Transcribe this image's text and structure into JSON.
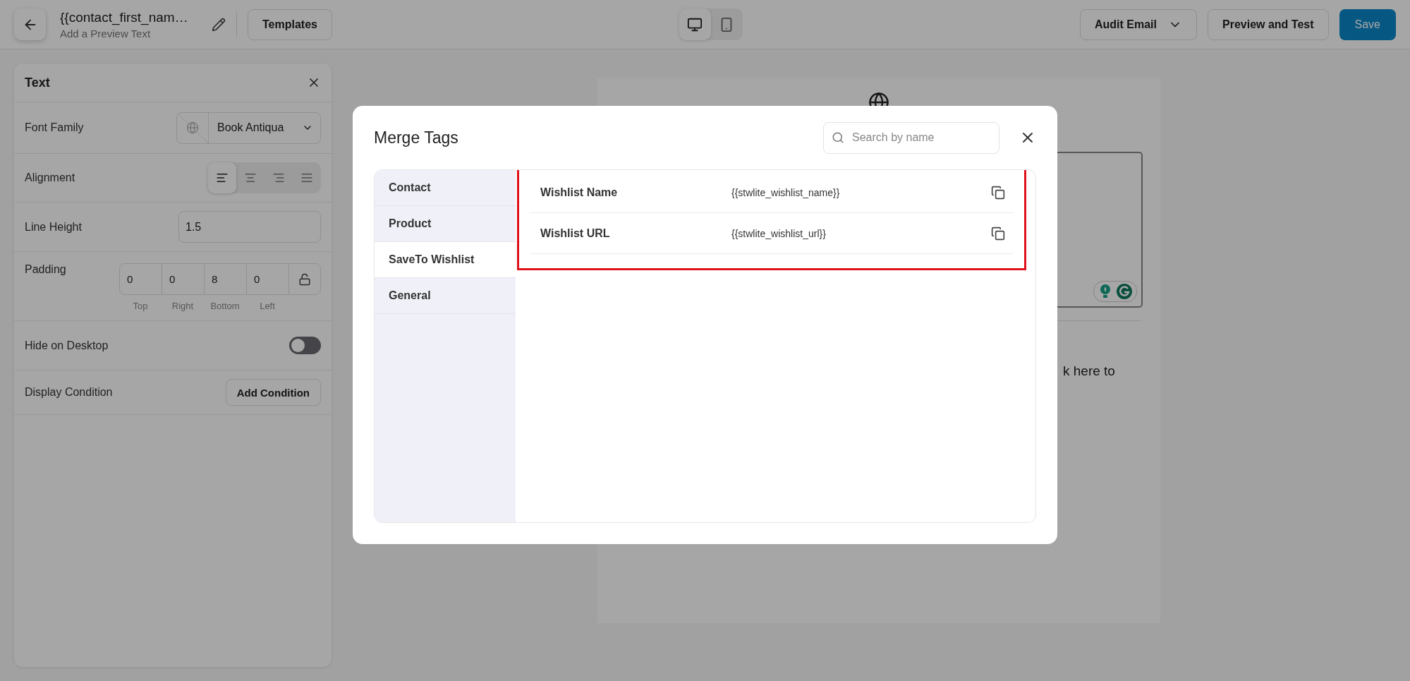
{
  "header": {
    "title": "{{contact_first_nam…",
    "subtitle": "Add a Preview Text",
    "templates_button": "Templates",
    "device_toggle": [
      {
        "kind": "desktop",
        "selected": true
      },
      {
        "kind": "mobile",
        "selected": false
      }
    ],
    "audit_button": "Audit Email",
    "preview_button": "Preview and Test",
    "save_button": "Save"
  },
  "settings_panel": {
    "title": "Text",
    "font_family": {
      "label": "Font Family",
      "value": "Book Antiqua"
    },
    "alignment": {
      "label": "Alignment",
      "options": [
        {
          "kind": "left",
          "selected": true
        },
        {
          "kind": "center",
          "selected": false
        },
        {
          "kind": "right",
          "selected": false
        },
        {
          "kind": "justify",
          "selected": false
        }
      ]
    },
    "line_height": {
      "label": "Line Height",
      "value": "1.5"
    },
    "padding": {
      "label": "Padding",
      "fields": [
        {
          "value": "0",
          "caption": "Top"
        },
        {
          "value": "0",
          "caption": "Right"
        },
        {
          "value": "8",
          "caption": "Bottom"
        },
        {
          "value": "0",
          "caption": "Left"
        }
      ]
    },
    "hide_on_desktop": {
      "label": "Hide on Desktop",
      "on": false
    },
    "display_condition": {
      "label": "Display Condition",
      "button": "Add Condition"
    }
  },
  "canvas": {
    "text_fragment": "k here to"
  },
  "modal": {
    "title": "Merge Tags",
    "search": {
      "placeholder": "Search by name"
    },
    "categories": [
      {
        "label": "Contact",
        "selected": false
      },
      {
        "label": "Product",
        "selected": false
      },
      {
        "label": "SaveTo Wishlist",
        "selected": true
      },
      {
        "label": "General",
        "selected": false
      }
    ],
    "highlighted": true,
    "tags": [
      {
        "name": "Wishlist Name",
        "code": "{{stwlite_wishlist_name}}"
      },
      {
        "name": "Wishlist URL",
        "code": "{{stwlite_wishlist_url}}"
      }
    ]
  }
}
